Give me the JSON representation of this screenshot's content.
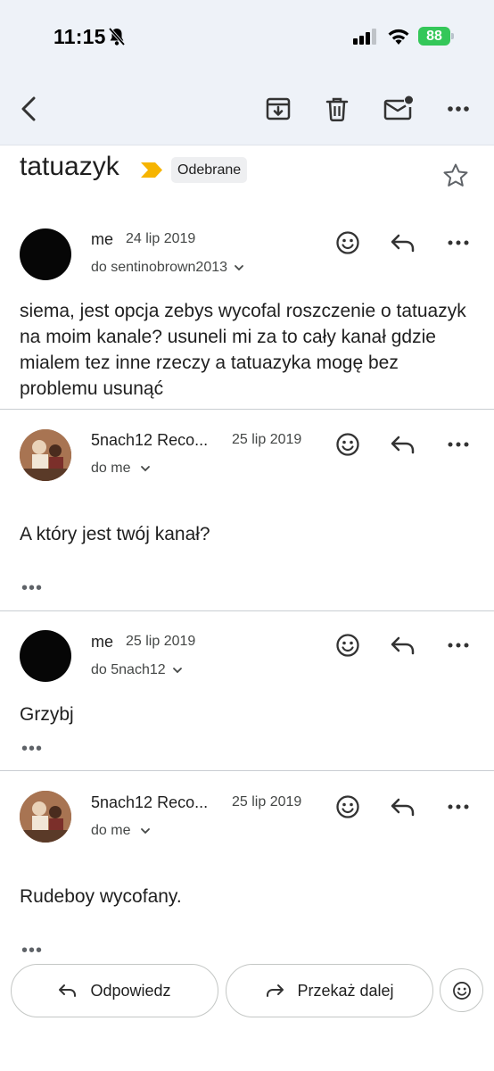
{
  "status_bar": {
    "time": "11:15",
    "battery": "88"
  },
  "toolbar": {
    "back_icon": "chevron-left-icon",
    "archive_icon": "archive-icon",
    "delete_icon": "trash-icon",
    "mark_unread_icon": "mail-unread-icon",
    "more_icon": "more-horizontal-icon"
  },
  "subject": {
    "title": "tatuazyk",
    "label": "Odebrane",
    "importance_color": "#f6b400"
  },
  "messages": [
    {
      "sender": "me",
      "date": "24 lip 2019",
      "recipient": "do sentinobrown2013",
      "body": "siema, jest opcja zebys wycofal roszczenie o tatuazyk na moim kanale? usuneli mi za to cały kanał gdzie mialem tez inne rzeczy a tatuazyka mogę bez problemu usunąć"
    },
    {
      "sender": "5nach12 Reco...",
      "date": "25 lip 2019",
      "recipient": "do me",
      "body": "A który jest twój kanał?",
      "ellipsis": "•••"
    },
    {
      "sender": "me",
      "date": "25 lip 2019",
      "recipient": "do 5nach12",
      "body": "Grzybj",
      "ellipsis": "•••"
    },
    {
      "sender": "5nach12 Reco...",
      "date": "25 lip 2019",
      "recipient": "do me",
      "body": "Rudeboy wycofany.",
      "ellipsis": "•••"
    }
  ],
  "bottom_actions": {
    "reply": "Odpowiedz",
    "forward": "Przekaż dalej"
  }
}
